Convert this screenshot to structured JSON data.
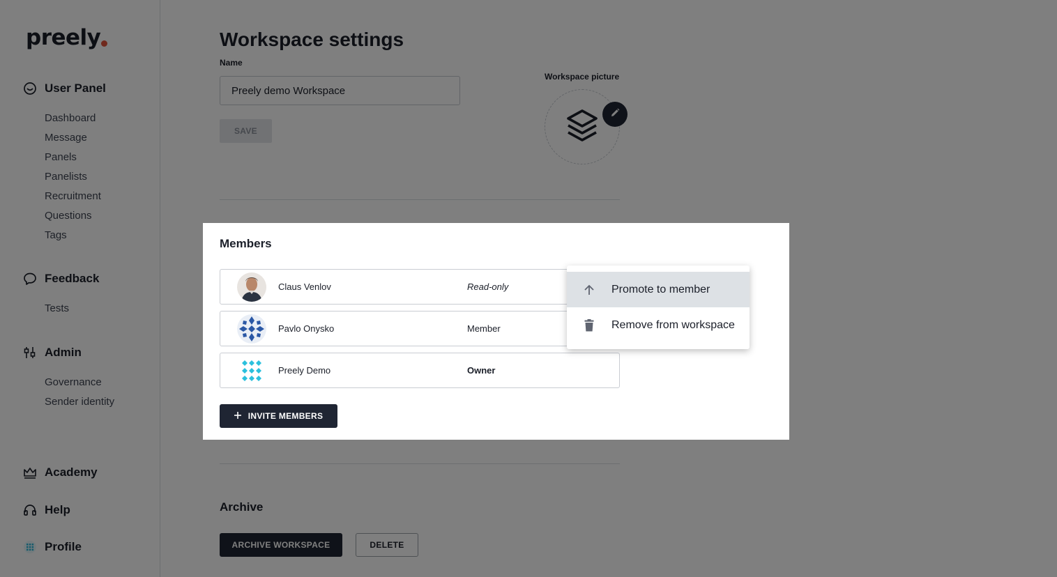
{
  "brand": {
    "logo_text": "preely"
  },
  "sidebar": {
    "sections": [
      {
        "label": "User Panel",
        "icon": "smile-icon",
        "items": [
          "Dashboard",
          "Message",
          "Panels",
          "Panelists",
          "Recruitment",
          "Questions",
          "Tags"
        ]
      },
      {
        "label": "Feedback",
        "icon": "chat-bubble-icon",
        "items": [
          "Tests"
        ]
      },
      {
        "label": "Admin",
        "icon": "sliders-icon",
        "items": [
          "Governance",
          "Sender identity"
        ]
      }
    ],
    "bottom": [
      {
        "label": "Academy",
        "icon": "crown-icon"
      },
      {
        "label": "Help",
        "icon": "headset-icon"
      },
      {
        "label": "Profile",
        "icon": "profile-avatar-icon"
      }
    ]
  },
  "settings": {
    "title": "Workspace settings",
    "name_label": "Name",
    "name_value": "Preely demo Workspace",
    "save_label": "SAVE",
    "picture_label": "Workspace picture"
  },
  "members": {
    "title": "Members",
    "rows": [
      {
        "name": "Claus Venlov",
        "role": "Read-only"
      },
      {
        "name": "Pavlo Onysko",
        "role": "Member"
      },
      {
        "name": "Preely Demo",
        "role": "Owner"
      }
    ],
    "invite_label": "INVITE MEMBERS"
  },
  "menu": {
    "items": [
      {
        "label": "Promote to member",
        "icon": "arrow-up-icon"
      },
      {
        "label": "Remove from workspace",
        "icon": "trash-icon"
      }
    ]
  },
  "archive": {
    "title": "Archive",
    "archive_label": "ARCHIVE WORKSPACE",
    "delete_label": "DELETE"
  },
  "colors": {
    "primary_dark": "#1f2533",
    "logo_dot": "#e0533a",
    "overlay": "rgba(0,0,0,0.5)",
    "menu_active": "#dde1e5"
  }
}
